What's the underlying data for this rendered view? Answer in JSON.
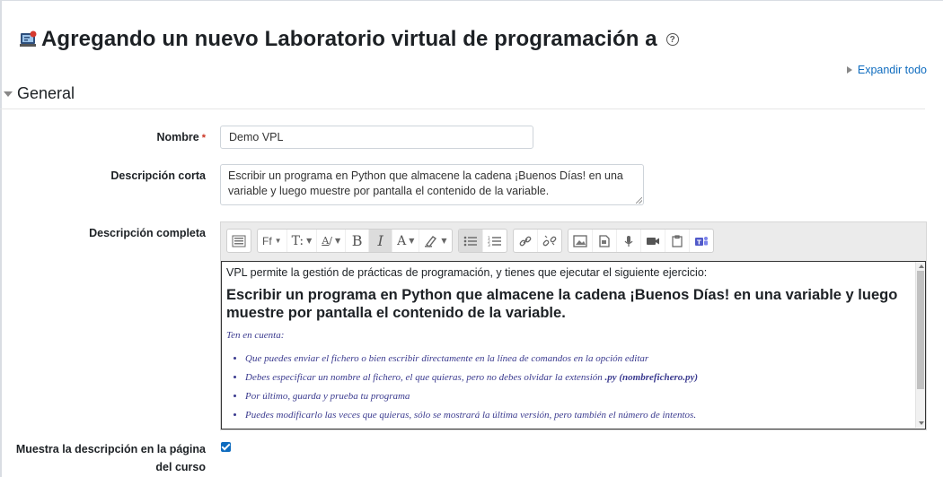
{
  "header": {
    "title": "Agregando un nuevo Laboratorio virtual de programación a",
    "help_icon": "question-circle-icon",
    "module_icon": "vpl-module-icon"
  },
  "expand_all_label": "Expandir todo",
  "section": {
    "label": "General"
  },
  "fields": {
    "name": {
      "label": "Nombre",
      "required_marker": "*",
      "value": "Demo VPL"
    },
    "short_description": {
      "label": "Descripción corta",
      "value": "Escribir un programa en Python que almacene la cadena ¡Buenos Días! en una variable y luego muestre por pantalla el contenido de la variable."
    },
    "full_description": {
      "label": "Descripción completa"
    },
    "show_description": {
      "label": "Muestra la descripción en la página del curso",
      "checked": true
    }
  },
  "editor": {
    "toolbar_groups": [
      [
        "toolbar-toggle-icon"
      ],
      [
        "font-family-icon",
        "font-size-icon",
        "font-color-icon",
        "bold-icon",
        "italic-icon",
        "text-color-icon",
        "highlight-icon"
      ],
      [
        "unordered-list-icon",
        "ordered-list-icon"
      ],
      [
        "link-icon",
        "unlink-icon"
      ],
      [
        "image-icon",
        "media-icon",
        "record-audio-icon",
        "record-video-icon",
        "manage-files-icon",
        "teams-icon"
      ]
    ],
    "content": {
      "intro": "VPL permite la gestión de prácticas de programación, y tienes que ejecutar el siguiente ejercicio:",
      "heading": "Escribir un programa en Python que almacene la cadena ¡Buenos Días! en una variable y luego muestre por pantalla el contenido de la variable.",
      "note": "Ten en cuenta:",
      "items": [
        "Que puedes enviar el fichero o bien escribir directamente en la línea de comandos en la opción editar",
        "Debes especificar un nombre al fichero, el que quieras, pero no debes olvidar la extensión",
        "Por último, guarda y prueba tu programa",
        "Puedes modificarlo las veces que quieras, sólo se mostrará la última versión, pero también el número de intentos."
      ],
      "items_1_bold": ".py (nombrefichero.py)"
    }
  },
  "colors": {
    "link": "#0f6cbf",
    "required": "#ca3120",
    "checkbox": "#0f6cbf",
    "note_text": "#3b3b8f"
  }
}
